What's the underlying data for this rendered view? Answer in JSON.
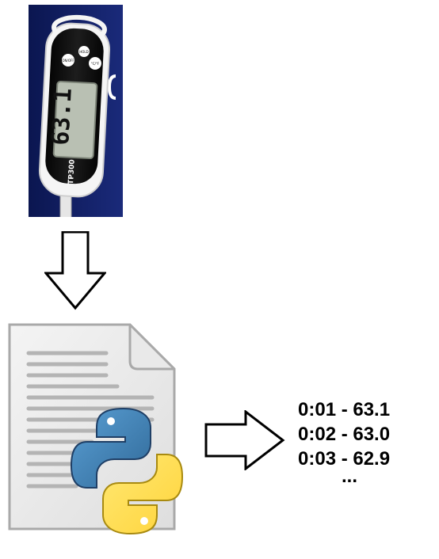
{
  "photo": {
    "subject": "thermometer-photo",
    "model_label": "TP300",
    "display_reading": "63.1",
    "button_labels": [
      "ON/OFF",
      "HOLD",
      "°C/°F"
    ]
  },
  "readings": {
    "lines": [
      "0:01 - 63.1",
      "0:02 - 63.0",
      "0:03 - 62.9"
    ],
    "ellipsis": "..."
  },
  "colors": {
    "photo_background": "#0f1c5e",
    "lcd_background": "#b9c0b3",
    "python_blue": "#3a6f9f",
    "python_yellow": "#f2c52f",
    "arrow_stroke": "#000000"
  },
  "icons": {
    "flow_down": "down-arrow-icon",
    "flow_right": "right-arrow-icon",
    "script": "python-script-file-icon"
  }
}
